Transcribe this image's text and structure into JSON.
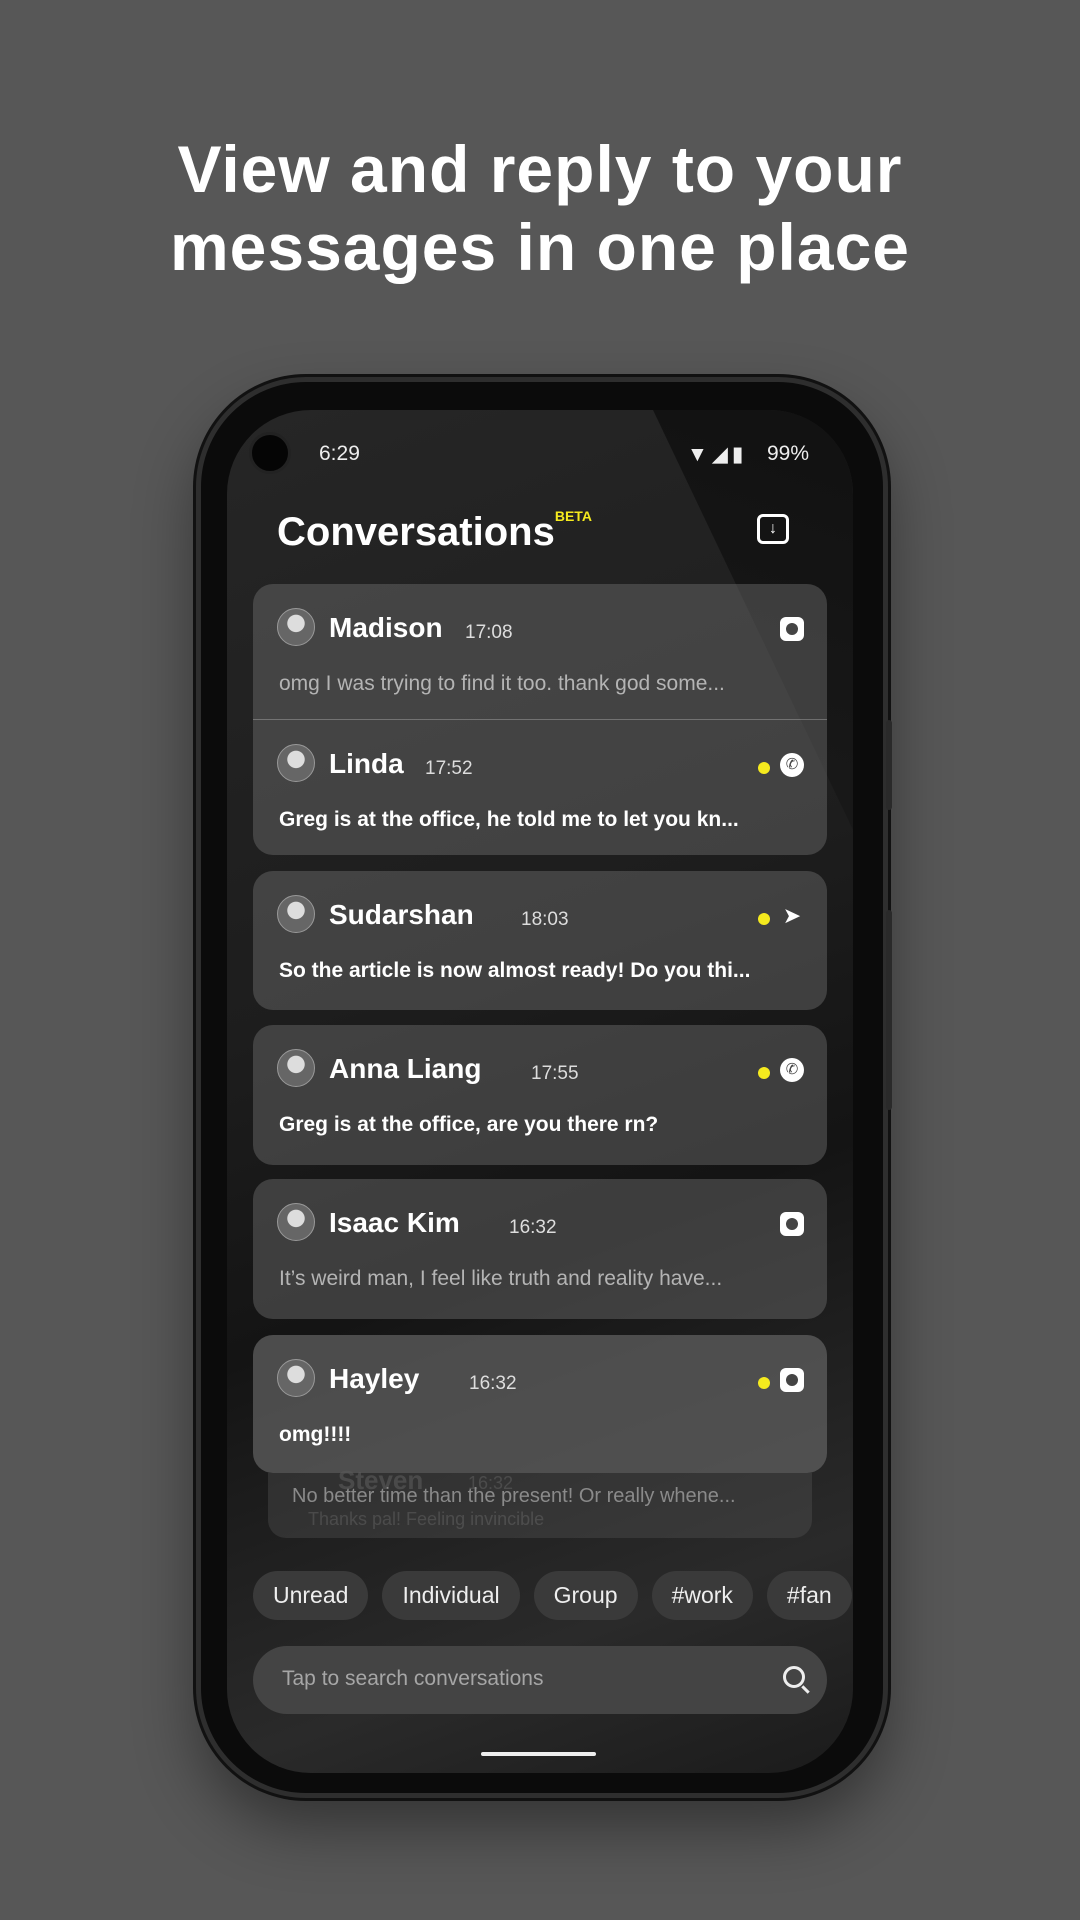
{
  "headline": {
    "line1": "View and reply to your",
    "line2": "messages in one place"
  },
  "status_bar": {
    "time": "6:29",
    "battery": "99%",
    "icons": [
      "wifi-icon",
      "signal-icon",
      "battery-icon"
    ]
  },
  "header": {
    "title": "Conversations",
    "badge": "BETA",
    "archive_icon": "archive-download-icon"
  },
  "accent_color": "#f5ea1e",
  "conversations": [
    {
      "name": "Madison",
      "time": "17:08",
      "message": "omg I was trying to find it too. thank god some...",
      "unread": false,
      "platform": "instagram"
    },
    {
      "name": "Linda",
      "time": "17:52",
      "message": "Greg is at the office, he told me to let you kn...",
      "unread": true,
      "platform": "whatsapp"
    },
    {
      "name": "Sudarshan",
      "time": "18:03",
      "message": "So the article is now almost ready! Do you thi...",
      "unread": true,
      "platform": "telegram"
    },
    {
      "name": "Anna Liang",
      "time": "17:55",
      "message": "Greg is at the office, are you there rn?",
      "unread": true,
      "platform": "whatsapp"
    },
    {
      "name": "Isaac Kim",
      "time": "16:32",
      "message": "It’s weird man, I feel like truth and reality have...",
      "unread": false,
      "platform": "instagram"
    },
    {
      "name": "Hayley",
      "time": "16:32",
      "message": "omg!!!!",
      "unread": true,
      "platform": "instagram"
    }
  ],
  "ghost": {
    "name": "Steven",
    "time": "16:32",
    "message": "No better time than the present! Or really whene...",
    "message2": "Thanks pal! Feeling invincible"
  },
  "filters": [
    "Unread",
    "Individual",
    "Group",
    "#work",
    "#fan"
  ],
  "search": {
    "placeholder": "Tap to search conversations"
  }
}
